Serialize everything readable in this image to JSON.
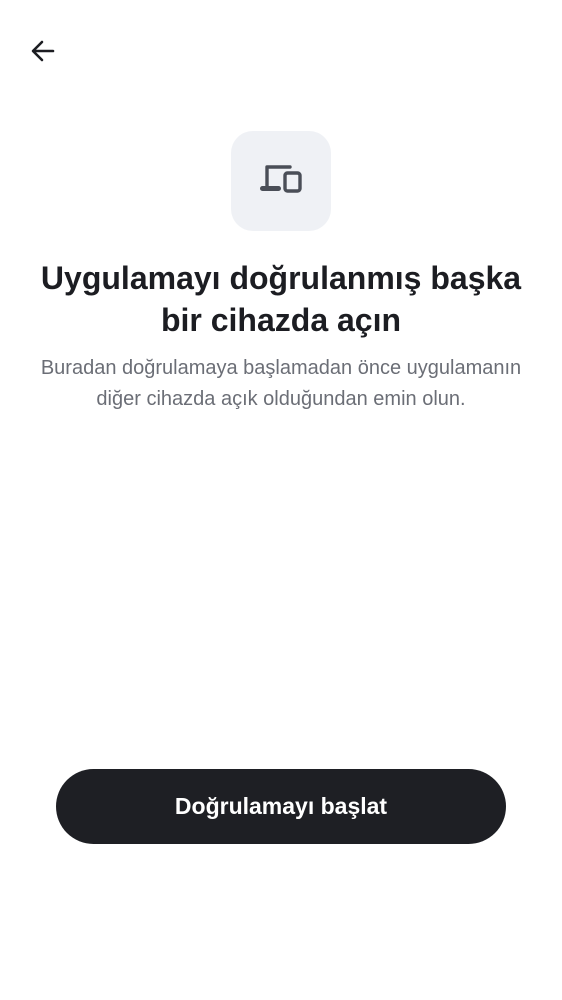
{
  "header": {
    "back_icon": "arrow-left-icon"
  },
  "hero": {
    "icon": "devices-icon",
    "icon_tile_color": "#eff1f5",
    "icon_color": "#4a4e57"
  },
  "content": {
    "title": "Uygulamayı doğrulanmış başka bir cihazda açın",
    "description": "Buradan doğrulamaya başlamadan önce uygulamanın diğer cihazda açık olduğundan emin olun."
  },
  "actions": {
    "start_label": "Doğrulamayı başlat",
    "button_color": "#1e1f24"
  }
}
